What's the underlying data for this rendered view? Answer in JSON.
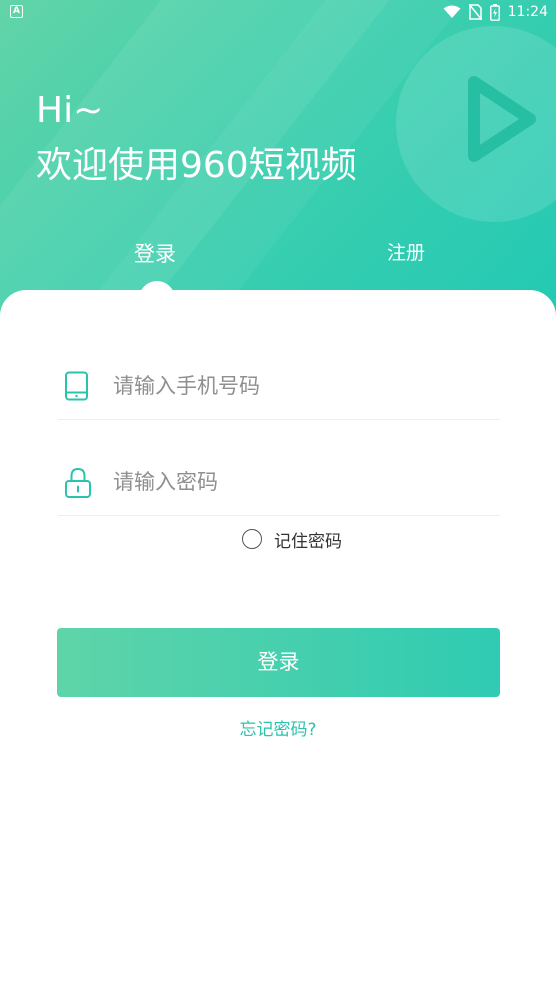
{
  "status_bar": {
    "app_icon_letter": "A",
    "time": "11:24",
    "icons": [
      "wifi-icon",
      "no-sim-icon",
      "battery-icon"
    ]
  },
  "header": {
    "greeting": "Hi~",
    "welcome": "欢迎使用960短视频"
  },
  "tabs": {
    "login_label": "登录",
    "register_label": "注册",
    "active": "login"
  },
  "form": {
    "phone": {
      "placeholder": "请输入手机号码",
      "value": "",
      "icon": "tablet-icon"
    },
    "password": {
      "placeholder": "请输入密码",
      "value": "",
      "icon": "lock-icon"
    },
    "remember_label": "记住密码",
    "remember_checked": false,
    "submit_label": "登录",
    "forgot_label": "忘记密码?"
  },
  "colors": {
    "accent": "#2cc3ad",
    "hero_start": "#62d4a8",
    "hero_end": "#22c9b4"
  }
}
